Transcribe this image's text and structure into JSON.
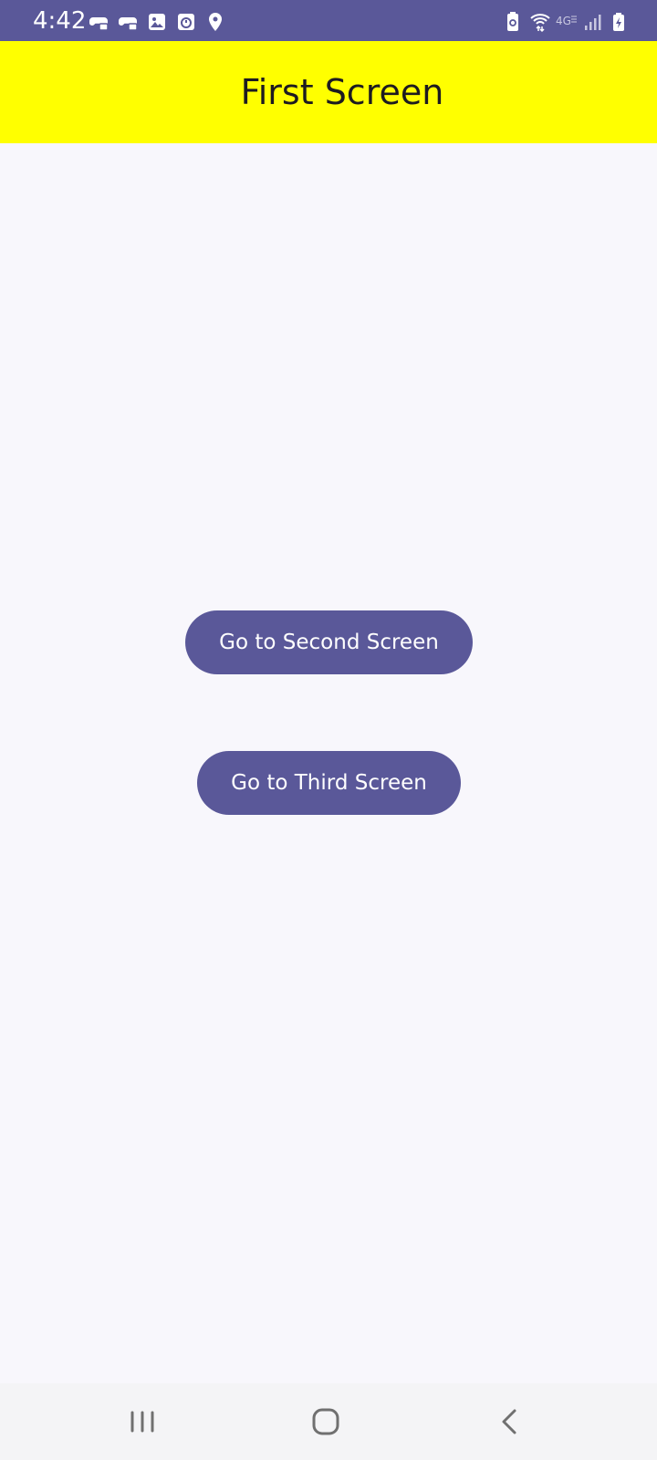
{
  "status_bar": {
    "time": "4:42",
    "left_icons": [
      "game-controller-icon",
      "game-controller-icon",
      "gallery-icon",
      "timer-icon",
      "location-pin-icon"
    ],
    "right_icons": [
      "battery-saver-icon",
      "wifi-icon",
      "network-4g-icon",
      "signal-icon",
      "battery-charging-icon"
    ]
  },
  "top_bar": {
    "title": "First Screen"
  },
  "buttons": {
    "second_label": "Go to Second Screen",
    "third_label": "Go to Third Screen"
  },
  "system_nav": {
    "icons": [
      "recent-apps-icon",
      "home-icon",
      "back-icon"
    ]
  },
  "colors": {
    "accent": "#5a5899",
    "top_bar": "#ffff00",
    "background": "#f8f7fc"
  }
}
